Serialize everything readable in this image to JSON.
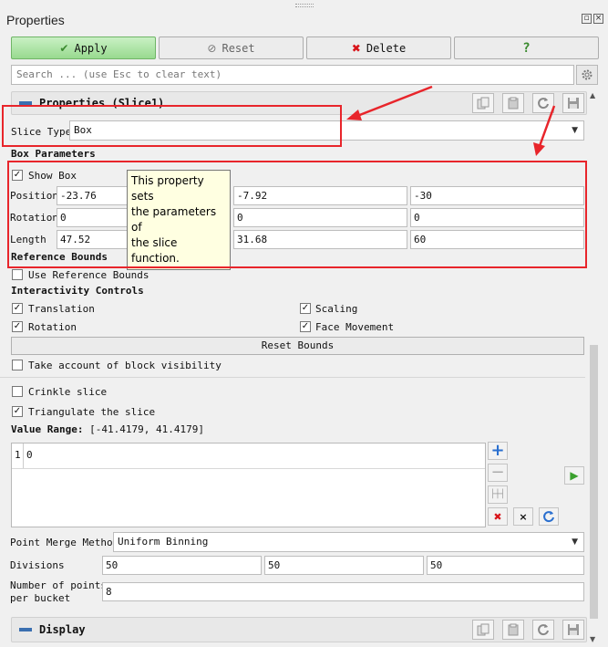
{
  "panel": {
    "title": "Properties"
  },
  "toolbar": {
    "apply": "Apply",
    "reset": "Reset",
    "delete": "Delete",
    "help": "?"
  },
  "search": {
    "placeholder": "Search ... (use Esc to clear text)"
  },
  "properties_section": {
    "title": "Properties (Slice1)"
  },
  "slice_type": {
    "label": "Slice Type",
    "value": "Box"
  },
  "box_params": {
    "heading": "Box Parameters",
    "show_box": "Show Box",
    "position": {
      "label": "Position",
      "values": [
        "-23.76",
        "-7.92",
        "-30"
      ]
    },
    "rotation": {
      "label": "Rotation",
      "values": [
        "0",
        "0",
        "0"
      ]
    },
    "length": {
      "label": "Length",
      "values": [
        "47.52",
        "31.68",
        "60"
      ]
    },
    "tooltip": [
      "This property sets",
      "the parameters of",
      "the slice function."
    ]
  },
  "reference_bounds": {
    "heading": "Reference Bounds",
    "use": "Use Reference Bounds"
  },
  "interactivity": {
    "heading": "Interactivity Controls",
    "translation": "Translation",
    "scaling": "Scaling",
    "rotation": "Rotation",
    "face_movement": "Face Movement",
    "reset_bounds": "Reset Bounds"
  },
  "block_visibility": "Take account of block visibility",
  "crinkle": "Crinkle slice",
  "triangulate": "Triangulate the slice",
  "value_range": {
    "label": "Value Range:",
    "value": "[-41.4179, 41.4179]"
  },
  "values_list": {
    "rows": [
      {
        "index": "1",
        "value": "0"
      }
    ]
  },
  "merge": {
    "label": "Point Merge Method",
    "value": "Uniform Binning"
  },
  "divisions": {
    "label": "Divisions",
    "values": [
      "50",
      "50",
      "50"
    ]
  },
  "points_per_bucket": {
    "label1": "Number of points",
    "label2": "per bucket",
    "value": "8"
  },
  "display_section": {
    "title": "Display"
  },
  "colors": {
    "red": "#e8252b",
    "apply_green": "#98da8f",
    "section_blue": "#3a6fb0"
  }
}
